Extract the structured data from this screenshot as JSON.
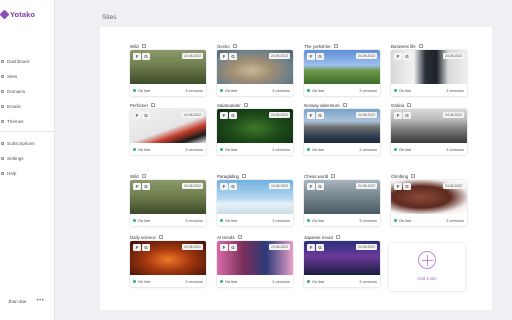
{
  "app": {
    "logo_text": "Yotako"
  },
  "sidebar": {
    "items": [
      {
        "label": "Dashboard",
        "icon": "dashboard-icon"
      },
      {
        "label": "Sites",
        "icon": "sites-icon"
      },
      {
        "label": "Domains",
        "icon": "domains-icon"
      },
      {
        "label": "Emails",
        "icon": "emails-icon"
      },
      {
        "label": "Themes",
        "icon": "themes-icon"
      }
    ],
    "items2": [
      {
        "label": "Subscriptions",
        "icon": "subscriptions-icon"
      },
      {
        "label": "Settings",
        "icon": "settings-icon"
      },
      {
        "label": "Help",
        "icon": "help-icon"
      }
    ],
    "user": {
      "name": "Jhon doe",
      "menu": "•••"
    }
  },
  "main": {
    "title": "Sites"
  },
  "sites": [
    {
      "name": "Wild",
      "date": "24.06.2022",
      "status": "On line",
      "versions": "3 versions",
      "theme": "wild"
    },
    {
      "name": "Gecko",
      "date": "24.06.2022",
      "status": "On line",
      "versions": "3 versions",
      "theme": "gecko"
    },
    {
      "name": "The yorkshire",
      "date": "24.06.2022",
      "status": "On line",
      "versions": "3 versions",
      "theme": "landscape"
    },
    {
      "name": "Business life",
      "date": "24.06.2022",
      "status": "On line",
      "versions": "3 versions",
      "theme": "business"
    },
    {
      "name": "Perfomer",
      "date": "24.06.2022",
      "status": "On line",
      "versions": "3 versions",
      "theme": "performer"
    },
    {
      "name": "Salamander",
      "date": "24.06.2022",
      "status": "On line",
      "versions": "3 versions",
      "theme": "salamander"
    },
    {
      "name": "Norway adventure",
      "date": "24.06.2022",
      "status": "On line",
      "versions": "3 versions",
      "theme": "norway"
    },
    {
      "name": "Galicia",
      "date": "24.06.2022",
      "status": "On line",
      "versions": "3 versions",
      "theme": "galicia"
    },
    {
      "name": "Wild",
      "date": "24.06.2022",
      "status": "On line",
      "versions": "3 versions",
      "theme": "wild"
    },
    {
      "name": "Paragliding",
      "date": "24.06.2022",
      "status": "On line",
      "versions": "3 versions",
      "theme": "paragliding"
    },
    {
      "name": "Chess world",
      "date": "24.06.2022",
      "status": "On line",
      "versions": "3 versions",
      "theme": "chess"
    },
    {
      "name": "Climbing",
      "date": "24.06.2022",
      "status": "On line",
      "versions": "3 versions",
      "theme": "climbing"
    },
    {
      "name": "Daily science",
      "date": "24.06.2022",
      "status": "On line",
      "versions": "3 versions",
      "theme": "science"
    },
    {
      "name": "AI trends",
      "date": "24.06.2022",
      "status": "On line",
      "versions": "3 versions",
      "theme": "ai"
    },
    {
      "name": "Japanse mood",
      "date": "24.06.2022",
      "status": "On line",
      "versions": "3 versions",
      "theme": "japan"
    }
  ],
  "badges": {
    "b1": "F",
    "b2": "G"
  },
  "add_site": {
    "label": "Add a site"
  },
  "colors": {
    "accent": "#8a4fb8",
    "online": "#2bb673"
  }
}
